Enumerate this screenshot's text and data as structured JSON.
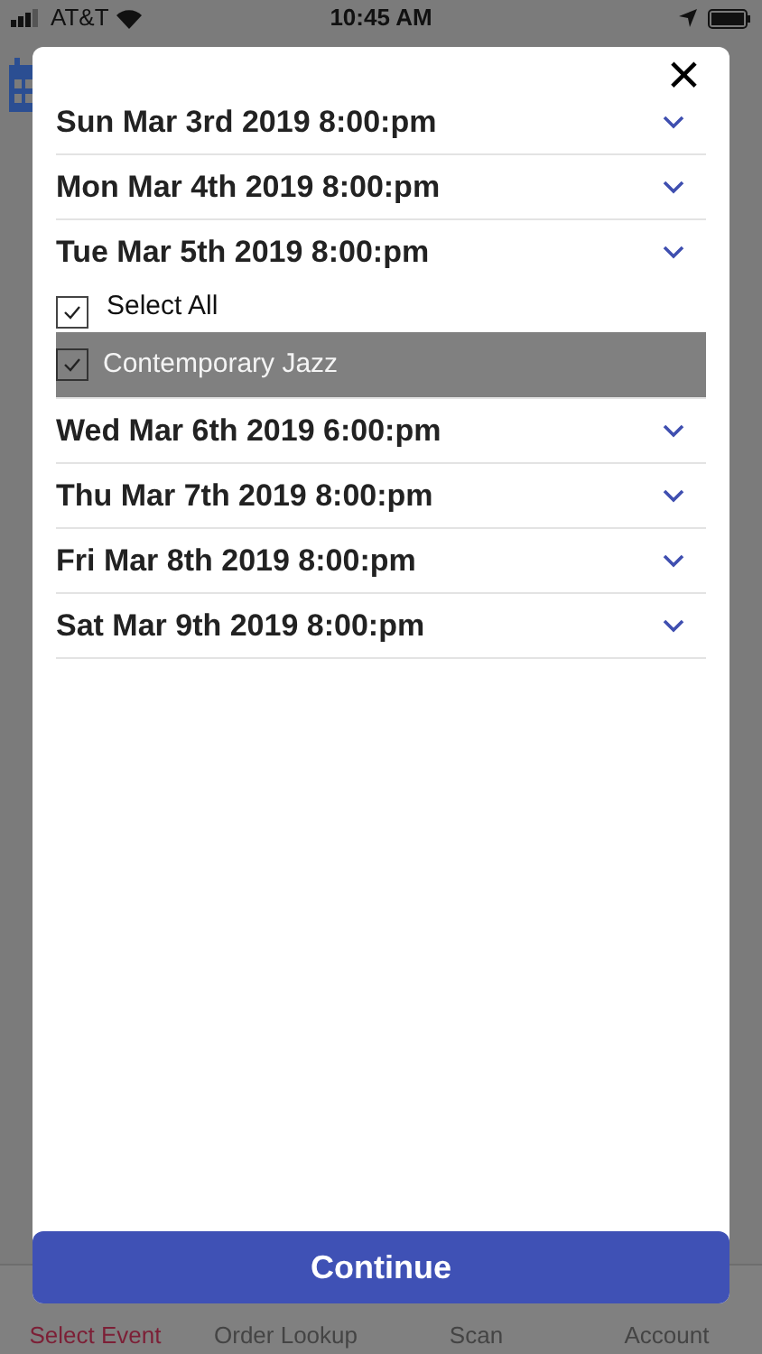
{
  "status_bar": {
    "carrier": "AT&T",
    "time": "10:45 AM"
  },
  "dialog": {
    "close": "×",
    "events": [
      {
        "label": "Sun Mar 3rd 2019 8:00:pm",
        "expanded": false
      },
      {
        "label": "Mon Mar 4th 2019 8:00:pm",
        "expanded": false
      },
      {
        "label": "Tue Mar 5th 2019 8:00:pm",
        "expanded": true,
        "options": [
          {
            "kind": "select_all",
            "label": "Select All",
            "checked": true
          },
          {
            "kind": "option",
            "label": "Contemporary Jazz",
            "checked": true,
            "selected": true
          }
        ]
      },
      {
        "label": "Wed Mar 6th 2019 6:00:pm",
        "expanded": false
      },
      {
        "label": "Thu Mar 7th 2019 8:00:pm",
        "expanded": false
      },
      {
        "label": "Fri Mar 8th 2019 8:00:pm",
        "expanded": false
      },
      {
        "label": "Sat Mar 9th 2019 8:00:pm",
        "expanded": false
      }
    ],
    "continue": "Continue"
  },
  "tab_bar": [
    {
      "label": "Select Event",
      "selected": true
    },
    {
      "label": "Order Lookup",
      "selected": false
    },
    {
      "label": "Scan",
      "selected": false
    },
    {
      "label": "Account",
      "selected": false
    }
  ]
}
